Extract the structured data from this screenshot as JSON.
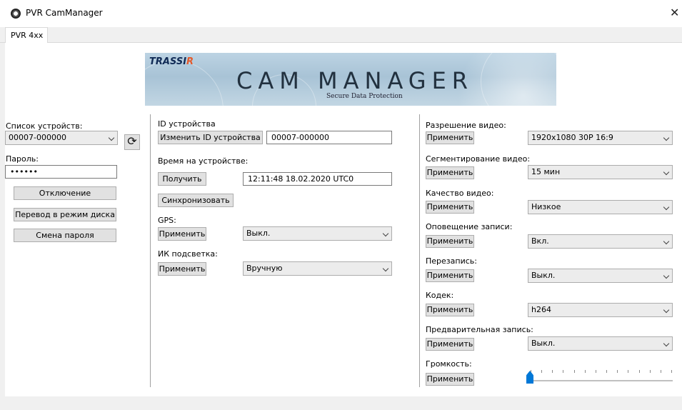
{
  "window": {
    "title": "PVR CamManager",
    "close": "✕"
  },
  "tabs": {
    "active": "PVR 4xx"
  },
  "banner": {
    "logo_pre": "TRASSI",
    "logo_r": "R",
    "title": "CAM MANAGER",
    "subtitle": "Secure Data Protection"
  },
  "left": {
    "devices_label": "Список устройств:",
    "device_selected": "00007-000000",
    "password_label": "Пароль:",
    "password_value": "••••••",
    "disconnect": "Отключение",
    "disk_mode": "Перевод в режим диска",
    "change_password": "Смена пароля",
    "refresh_icon": "refresh-icon"
  },
  "middle": {
    "id_label": "ID устройства",
    "change_id": "Изменить ID устройства",
    "id_value": "00007-000000",
    "time_label": "Время на устройстве:",
    "get": "Получить",
    "time_value": "12:11:48 18.02.2020 UTC0",
    "sync": "Синхронизовать",
    "gps_label": "GPS:",
    "gps_apply": "Применить",
    "gps_value": "Выкл.",
    "ir_label": "ИК подсветка:",
    "ir_apply": "Применить",
    "ir_value": "Вручную"
  },
  "right": {
    "apply": "Применить",
    "settings": [
      {
        "label": "Разрешение видео:",
        "value": "1920x1080 30P 16:9"
      },
      {
        "label": "Сегментирование видео:",
        "value": "15 мин"
      },
      {
        "label": "Качество видео:",
        "value": "Низкое"
      },
      {
        "label": "Оповещение записи:",
        "value": "Вкл."
      },
      {
        "label": "Перезапись:",
        "value": "Выкл."
      },
      {
        "label": "Кодек:",
        "value": "h264"
      },
      {
        "label": "Предварительная запись:",
        "value": "Выкл."
      }
    ],
    "volume_label": "Громкость:",
    "volume_level": 0
  }
}
